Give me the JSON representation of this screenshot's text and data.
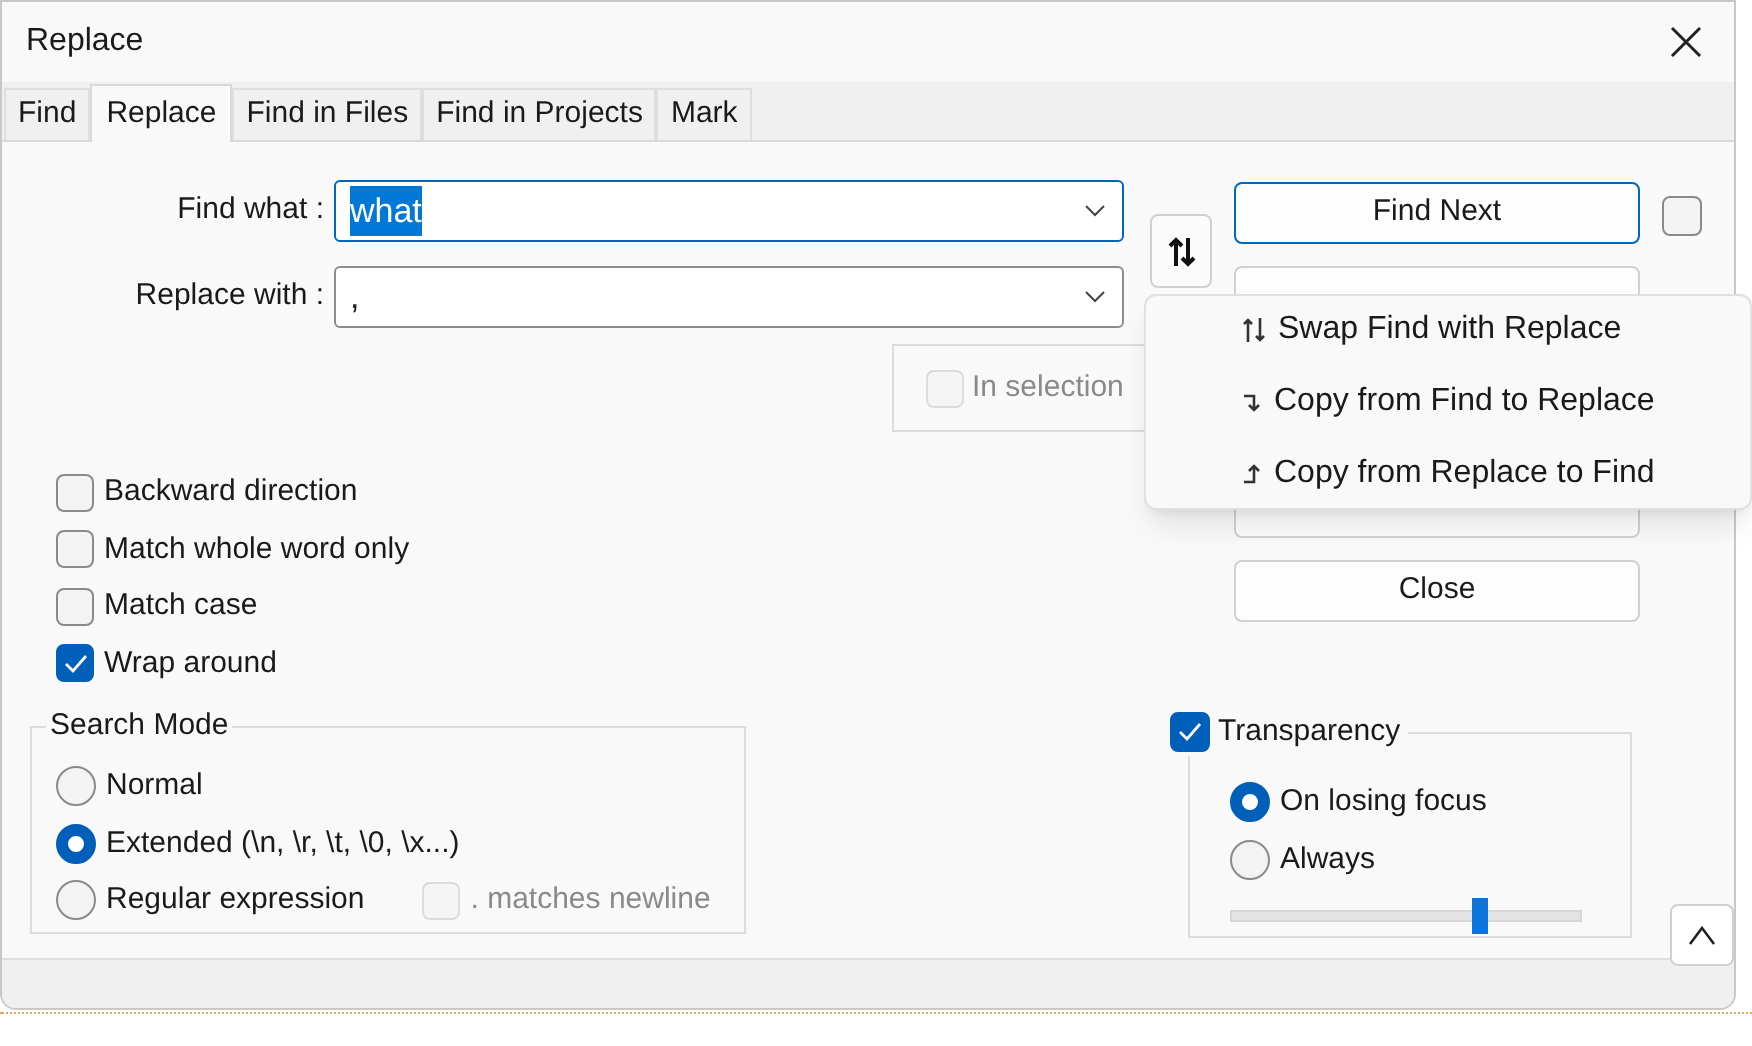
{
  "window": {
    "title": "Replace"
  },
  "tabs": [
    {
      "label": "Find",
      "selected": false
    },
    {
      "label": "Replace",
      "selected": true
    },
    {
      "label": "Find in Files",
      "selected": false
    },
    {
      "label": "Find in Projects",
      "selected": false
    },
    {
      "label": "Mark",
      "selected": false
    }
  ],
  "fields": [
    {
      "label": "Find what :",
      "value": "what",
      "value_selected": true,
      "focused": true
    },
    {
      "label": "Replace with :",
      "value": ",",
      "value_selected": false,
      "focused": false
    }
  ],
  "in_selection": {
    "label": "In selection",
    "checked": false,
    "disabled": true
  },
  "options": [
    {
      "label": "Backward direction",
      "checked": false
    },
    {
      "label": "Match whole word only",
      "checked": false
    },
    {
      "label": "Match case",
      "checked": false
    },
    {
      "label": "Wrap around",
      "checked": true
    }
  ],
  "search_mode": {
    "title": "Search Mode",
    "modes": [
      {
        "label": "Normal",
        "selected": false
      },
      {
        "label": "Extended (\\n, \\r, \\t, \\0, \\x...)",
        "selected": true
      },
      {
        "label": "Regular expression",
        "selected": false
      }
    ],
    "matches_newline": {
      "label": ". matches newline",
      "checked": false,
      "disabled": true
    }
  },
  "buttons": [
    {
      "kind": "text",
      "label": "Find Next",
      "default": true
    },
    {
      "kind": "covered"
    },
    {
      "kind": "covered"
    },
    {
      "kind": "text",
      "label": "Close",
      "default": false
    }
  ],
  "find_next_option": {
    "checked": false
  },
  "transparency": {
    "label": "Transparency",
    "checked": true,
    "modes": [
      {
        "label": "On losing focus",
        "selected": true
      },
      {
        "label": "Always",
        "selected": false
      }
    ],
    "level": 0.71
  },
  "swap_menu": {
    "items": [
      {
        "kind": "swap",
        "label": "Swap Find with Replace"
      },
      {
        "kind": "down",
        "label": "Copy from Find to Replace"
      },
      {
        "kind": "up",
        "label": "Copy from Replace to Find"
      }
    ]
  }
}
